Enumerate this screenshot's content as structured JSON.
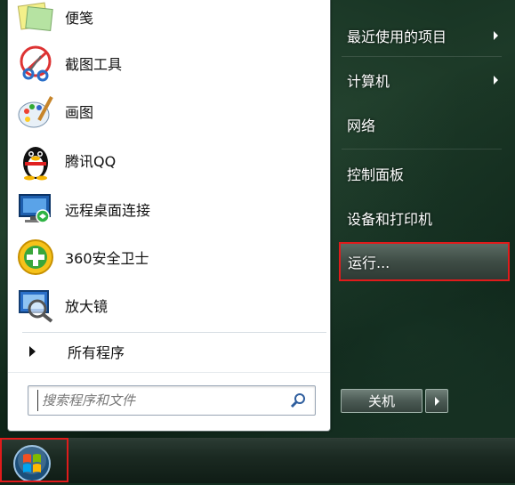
{
  "programs": [
    {
      "label": "便笺",
      "icon": "sticky-notes-icon"
    },
    {
      "label": "截图工具",
      "icon": "snipping-tool-icon"
    },
    {
      "label": "画图",
      "icon": "paint-icon"
    },
    {
      "label": "腾讯QQ",
      "icon": "qq-penguin-icon"
    },
    {
      "label": "远程桌面连接",
      "icon": "remote-desktop-icon"
    },
    {
      "label": "360安全卫士",
      "icon": "360-security-icon"
    },
    {
      "label": "放大镜",
      "icon": "magnifier-icon"
    }
  ],
  "all_programs": "所有程序",
  "search": {
    "placeholder": "搜索程序和文件"
  },
  "right_menu": [
    {
      "label": "最近使用的项目",
      "has_submenu": true
    },
    {
      "label": "计算机",
      "has_submenu": true
    },
    {
      "label": "网络",
      "has_submenu": false
    },
    {
      "label": "控制面板",
      "has_submenu": false
    },
    {
      "label": "设备和打印机",
      "has_submenu": false
    }
  ],
  "run_label": "运行...",
  "shutdown_label": "关机",
  "highlight_color": "#e01b1b"
}
